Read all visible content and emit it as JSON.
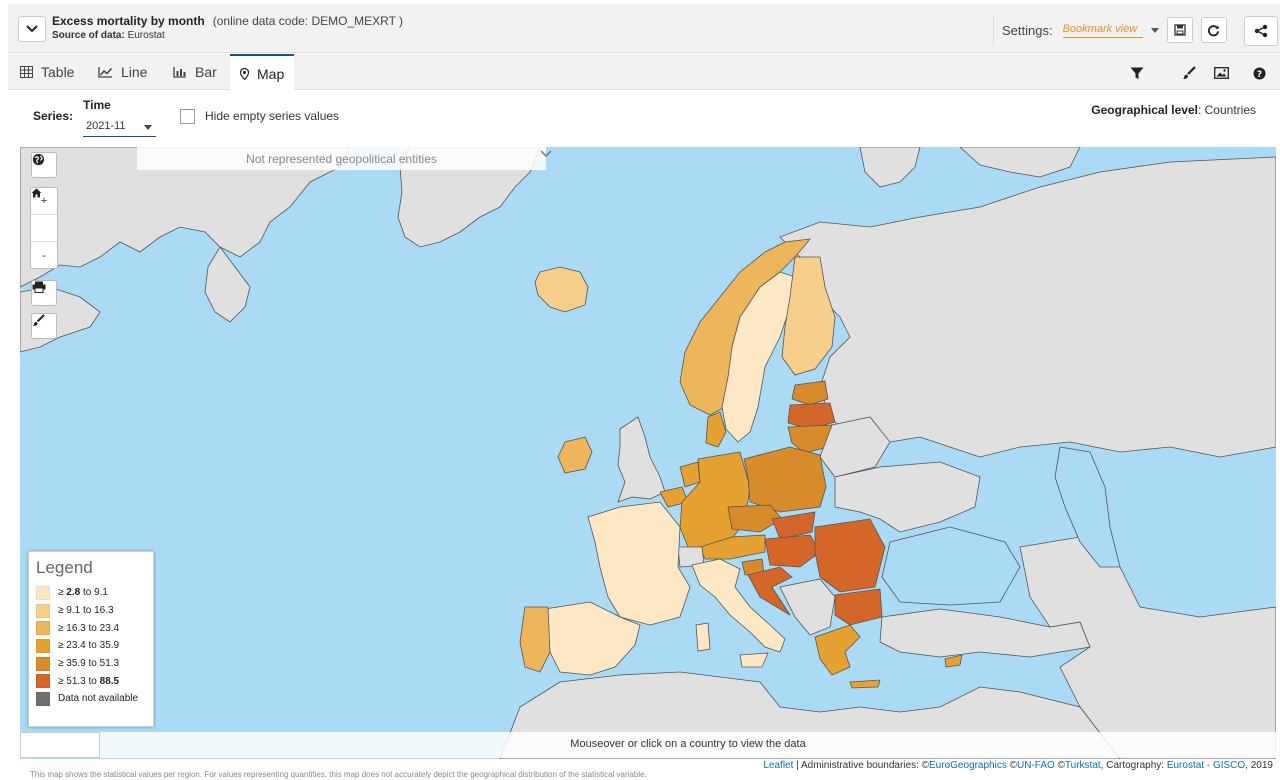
{
  "header": {
    "title": "Excess mortality by month",
    "code": "(online data code: DEMO_MEXRT )",
    "source_label": "Source of data:",
    "source": "Eurostat",
    "settings_label": "Settings:",
    "bookmark_view": "Bookmark view"
  },
  "tabs": [
    {
      "label": "Table",
      "icon": "table-icon"
    },
    {
      "label": "Line",
      "icon": "line-chart-icon"
    },
    {
      "label": "Bar",
      "icon": "bar-chart-icon"
    },
    {
      "label": "Map",
      "icon": "map-marker-icon",
      "active": true
    }
  ],
  "options": {
    "series_label": "Series:",
    "time_label": "Time",
    "time_value": "2021-11",
    "hide_empty_label": "Hide empty series values",
    "hide_empty_checked": false,
    "geo_level_label": "Geographical level",
    "geo_level_value": ": Countries"
  },
  "map": {
    "not_represented": "Not represented geopolitical entities",
    "hover_text": "Mouseover or click on a country to view the data",
    "controls": [
      "globe-icon",
      "zoom-in",
      "home-icon",
      "zoom-out",
      "print-icon",
      "brush-icon"
    ],
    "zoom_in": "+",
    "zoom_out": "-"
  },
  "legend": {
    "title": "Legend",
    "classes": [
      {
        "pre": "≥ ",
        "low": "2.8",
        "low_bold": true,
        "mid": " to ",
        "high": "9.1",
        "high_bold": false,
        "color": "#fde8c5"
      },
      {
        "pre": "≥ ",
        "low": "9.1",
        "low_bold": false,
        "mid": " to ",
        "high": "16.3",
        "high_bold": false,
        "color": "#f5cf8b"
      },
      {
        "pre": "≥ ",
        "low": "16.3",
        "low_bold": false,
        "mid": " to ",
        "high": "23.4",
        "high_bold": false,
        "color": "#edb55c"
      },
      {
        "pre": "≥ ",
        "low": "23.4",
        "low_bold": false,
        "mid": " to ",
        "high": "35.9",
        "high_bold": false,
        "color": "#e5a232"
      },
      {
        "pre": "≥ ",
        "low": "35.9",
        "low_bold": false,
        "mid": " to ",
        "high": "51.3",
        "high_bold": false,
        "color": "#d88b2b"
      },
      {
        "pre": "≥ ",
        "low": "51.3",
        "low_bold": false,
        "mid": " to ",
        "high": "88.5",
        "high_bold": true,
        "color": "#d5662a"
      },
      {
        "pre": "",
        "low": "",
        "mid": "Data not available",
        "high": "",
        "color": "#6f6f6f"
      }
    ],
    "land_color": "#e0e0e0",
    "sea_color": "#aadaf4"
  },
  "attribution": {
    "leaflet": "Leaflet",
    "sep1": " | Administrative boundaries: ©",
    "eurogeo": "EuroGeographics",
    "sep2": " ©",
    "unfao": "UN-FAO",
    "sep3": " ©",
    "turkstat": "Turkstat",
    "sep4": ", Cartography: ",
    "gisco": "Eurostat - GISCO",
    "year": ", 2019"
  },
  "disclaimer": "This map shows the statistical values per region. For values representing quantities, this map does not accurately depict the geographical distribution of the statistical variable."
}
